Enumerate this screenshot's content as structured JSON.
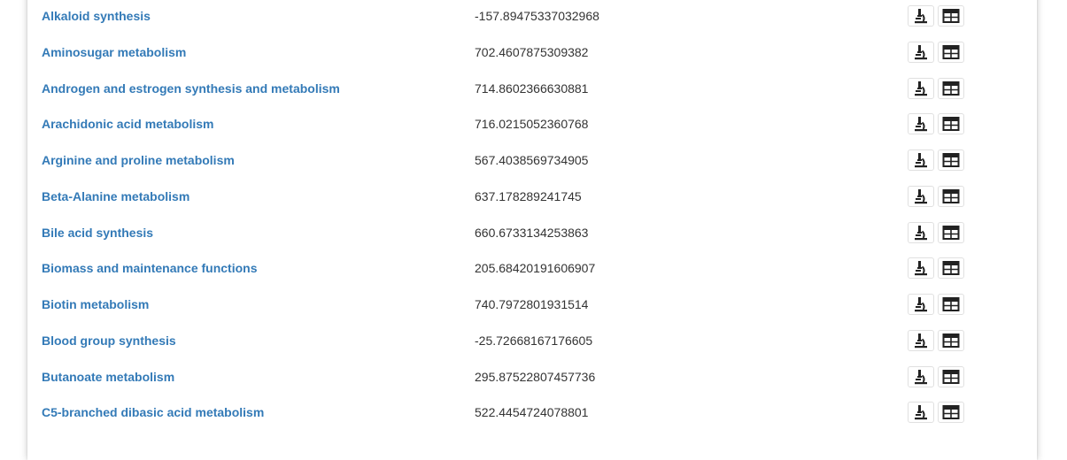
{
  "pathways": [
    {
      "name": "Alkaloid synthesis",
      "value": "-157.89475337032968"
    },
    {
      "name": "Aminosugar metabolism",
      "value": "702.4607875309382"
    },
    {
      "name": "Androgen and estrogen synthesis and metabolism",
      "value": "714.8602366630881"
    },
    {
      "name": "Arachidonic acid metabolism",
      "value": "716.0215052360768"
    },
    {
      "name": "Arginine and proline metabolism",
      "value": "567.4038569734905"
    },
    {
      "name": "Beta-Alanine metabolism",
      "value": "637.178289241745"
    },
    {
      "name": "Bile acid synthesis",
      "value": "660.6733134253863"
    },
    {
      "name": "Biomass and maintenance functions",
      "value": "205.68420191606907"
    },
    {
      "name": "Biotin metabolism",
      "value": "740.7972801931514"
    },
    {
      "name": "Blood group synthesis",
      "value": "-25.72668167176605"
    },
    {
      "name": "Butanoate metabolism",
      "value": "295.87522807457736"
    },
    {
      "name": "C5-branched dibasic acid metabolism",
      "value": "522.4454724078801"
    }
  ],
  "row_actions": {
    "icons": [
      "microscope-icon",
      "table-icon"
    ]
  },
  "colors": {
    "link": "#337ab7",
    "text": "#333333",
    "icon": "#222222"
  }
}
